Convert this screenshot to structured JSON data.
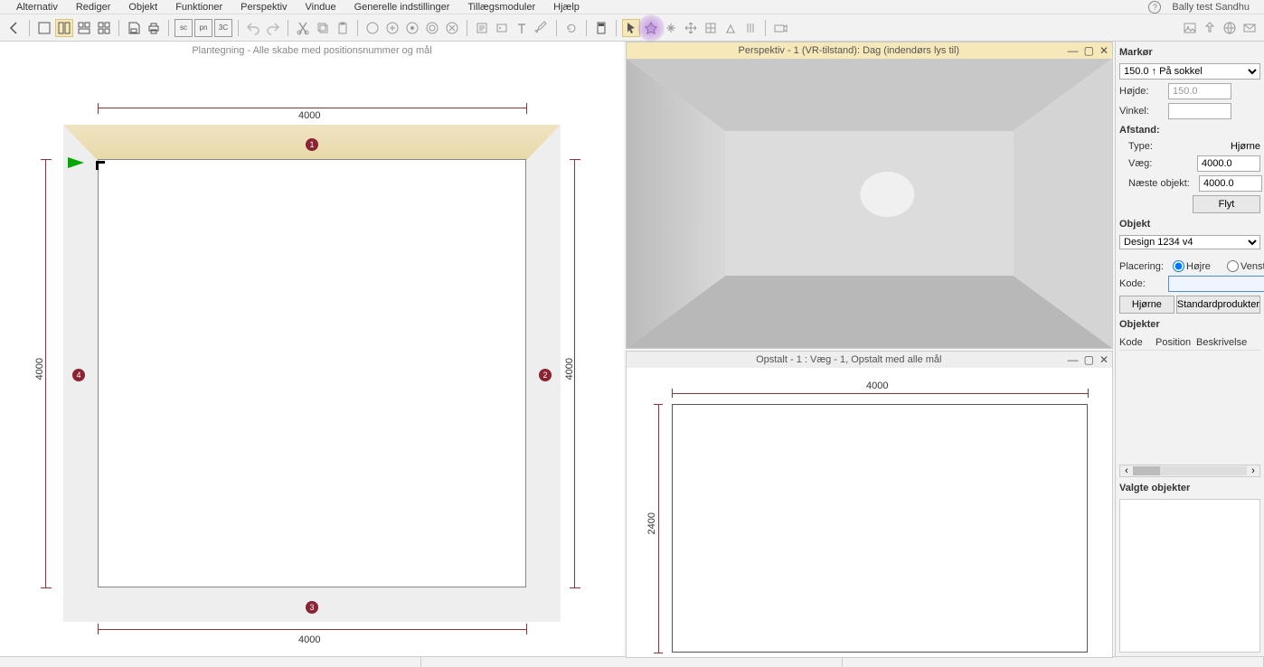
{
  "menu": {
    "alternativ": "Alternativ",
    "rediger": "Rediger",
    "objekt": "Objekt",
    "funktioner": "Funktioner",
    "perspektiv": "Perspektiv",
    "vindue": "Vindue",
    "generelle": "Generelle indstillinger",
    "tillaeg": "Tillægsmoduler",
    "hjaelp": "Hjælp",
    "help_symbol": "?",
    "user": "Bally test Sandhu"
  },
  "toolbar": {
    "sc": "sc",
    "pn": "pn",
    "threeC": "3C"
  },
  "planview": {
    "title": "Plantegning - Alle skabe med positionsnummer og mål",
    "dim_top": "4000",
    "dim_bottom": "4000",
    "dim_left": "4000",
    "dim_right": "4000",
    "wall1": "1",
    "wall2": "2",
    "wall3": "3",
    "wall4": "4"
  },
  "perspview": {
    "title": "Perspektiv - 1 (VR-tilstand): Dag (indendørs lys til)"
  },
  "elevview": {
    "title": "Opstalt - 1 : Væg - 1, Opstalt med alle mål",
    "dim_top": "4000",
    "dim_left": "2400"
  },
  "sidebar": {
    "markor_label": "Markør",
    "markor_value": "150.0",
    "markor_mode": "På sokkel",
    "hojde_label": "Højde:",
    "hojde_value": "150.0",
    "vinkel_label": "Vinkel:",
    "vinkel_value": "",
    "afstand_label": "Afstand:",
    "type_label": "Type:",
    "hjorne_label": "Hjørne",
    "vaeg_label": "Væg:",
    "vaeg_value": "4000.0",
    "naeste_label": "Næste objekt:",
    "naeste_value": "4000.0",
    "flyt_label": "Flyt",
    "objekt_label": "Objekt",
    "objekt_value": "Design 1234 v4",
    "placering_label": "Placering:",
    "hojre_label": "Højre",
    "venstre_label": "Venstre",
    "kode_label": "Kode:",
    "kode_value": "",
    "hjorne_btn": "Hjørne",
    "standard_btn": "Standardprodukter",
    "objekter_label": "Objekter",
    "col_kode": "Kode",
    "col_position": "Position",
    "col_beskrivelse": "Beskrivelse",
    "valgte_label": "Valgte objekter",
    "scroll_left": "‹",
    "scroll_right": "›"
  }
}
